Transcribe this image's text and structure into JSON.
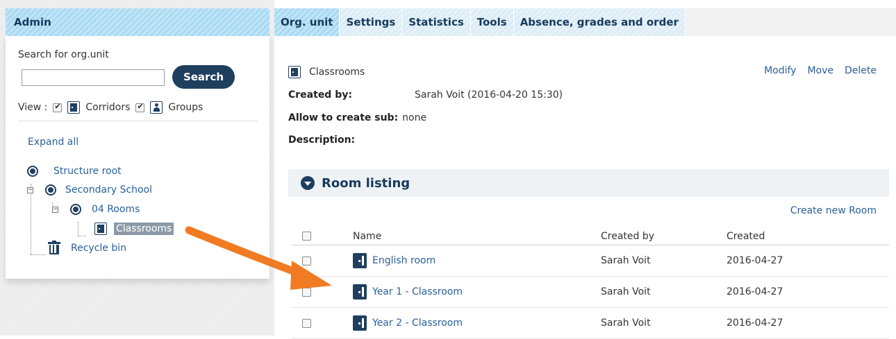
{
  "admin": {
    "title": "Admin",
    "search_label": "Search for org.unit",
    "search_placeholder": "",
    "search_button": "Search",
    "view_label": "View :",
    "view_options": [
      {
        "label": "Corridors",
        "checked": true,
        "icon": "door-icon"
      },
      {
        "label": "Groups",
        "checked": true,
        "icon": "person-icon"
      }
    ],
    "expand_all": "Expand all",
    "tree": {
      "root": "Structure root",
      "school": "Secondary School",
      "rooms": "04 Rooms",
      "classrooms": "Classrooms",
      "recycle_bin": "Recycle bin"
    }
  },
  "tabs": [
    {
      "label": "Org. unit",
      "active": true
    },
    {
      "label": "Settings",
      "active": false
    },
    {
      "label": "Statistics",
      "active": false
    },
    {
      "label": "Tools",
      "active": false
    },
    {
      "label": "Absence, grades and order",
      "active": false
    }
  ],
  "unit": {
    "name": "Classrooms",
    "actions": {
      "modify": "Modify",
      "move": "Move",
      "delete": "Delete"
    },
    "created_by_label": "Created by:",
    "created_by_value": "Sarah Voit (2016-04-20 15:30)",
    "allow_sub_label": "Allow to create sub:",
    "allow_sub_value": "none",
    "description_label": "Description:"
  },
  "room_listing": {
    "title": "Room listing",
    "create_link": "Create new Room",
    "columns": {
      "name": "Name",
      "created_by": "Created by",
      "created": "Created"
    },
    "rows": [
      {
        "name": "English room",
        "created_by": "Sarah Voit",
        "created": "2016-04-27"
      },
      {
        "name": "Year 1 - Classroom",
        "created_by": "Sarah Voit",
        "created": "2016-04-27"
      },
      {
        "name": "Year 2 - Classroom",
        "created_by": "Sarah Voit",
        "created": "2016-04-27"
      }
    ]
  },
  "colors": {
    "accent_dark": "#1f3f5f",
    "tab_active": "#b5def4",
    "link": "#2a5f9a",
    "annotation_arrow": "#f07b22"
  }
}
